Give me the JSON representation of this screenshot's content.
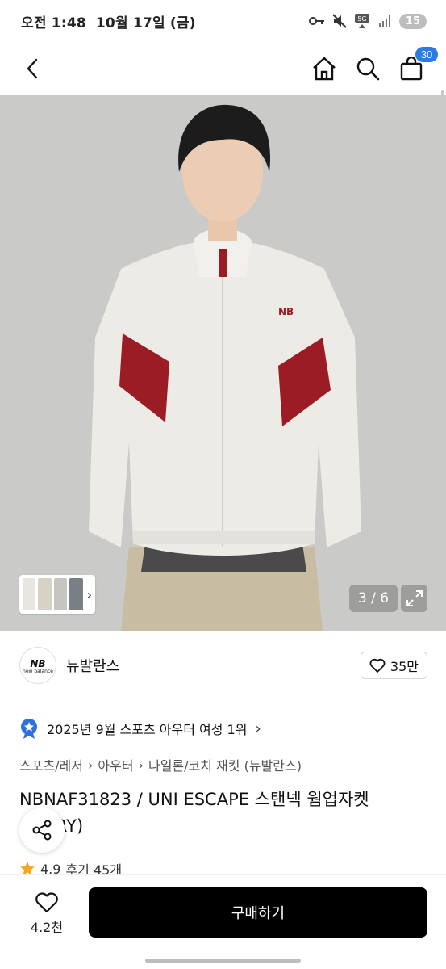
{
  "status_bar": {
    "time": "오전 1:48",
    "date": "10월 17일 (금)",
    "network": "5G",
    "battery": "15"
  },
  "app_bar": {
    "cart_count": "30"
  },
  "gallery": {
    "counter": "3 / 6",
    "colors": {
      "background": "#c9c9c7",
      "jacket": "#ecebe6",
      "accent": "#9b1c25",
      "pants": "#c8bca3"
    }
  },
  "brand": {
    "logo_text": "new balance",
    "name": "뉴발란스",
    "like_count": "35만"
  },
  "ranking": {
    "text": "2025년 9월 스포츠 아우터 여성 1위"
  },
  "breadcrumb": [
    "스포츠/레저",
    "아우터",
    "나일론/코치 재킷 (뉴발란스)"
  ],
  "product": {
    "title": "NBNAF31823 / UNI ESCAPE 스탠넥 웜업자켓 (IVORY)",
    "title_visible_line2": "RY)",
    "rating": "4.9",
    "review_text": "후기 45개"
  },
  "bottom_bar": {
    "wish_count": "4.2천",
    "buy_label": "구매하기"
  },
  "accent_colors": {
    "cart_badge": "#2c7be5",
    "rank_badge": "#2e6fe0",
    "star": "#f5a623"
  }
}
